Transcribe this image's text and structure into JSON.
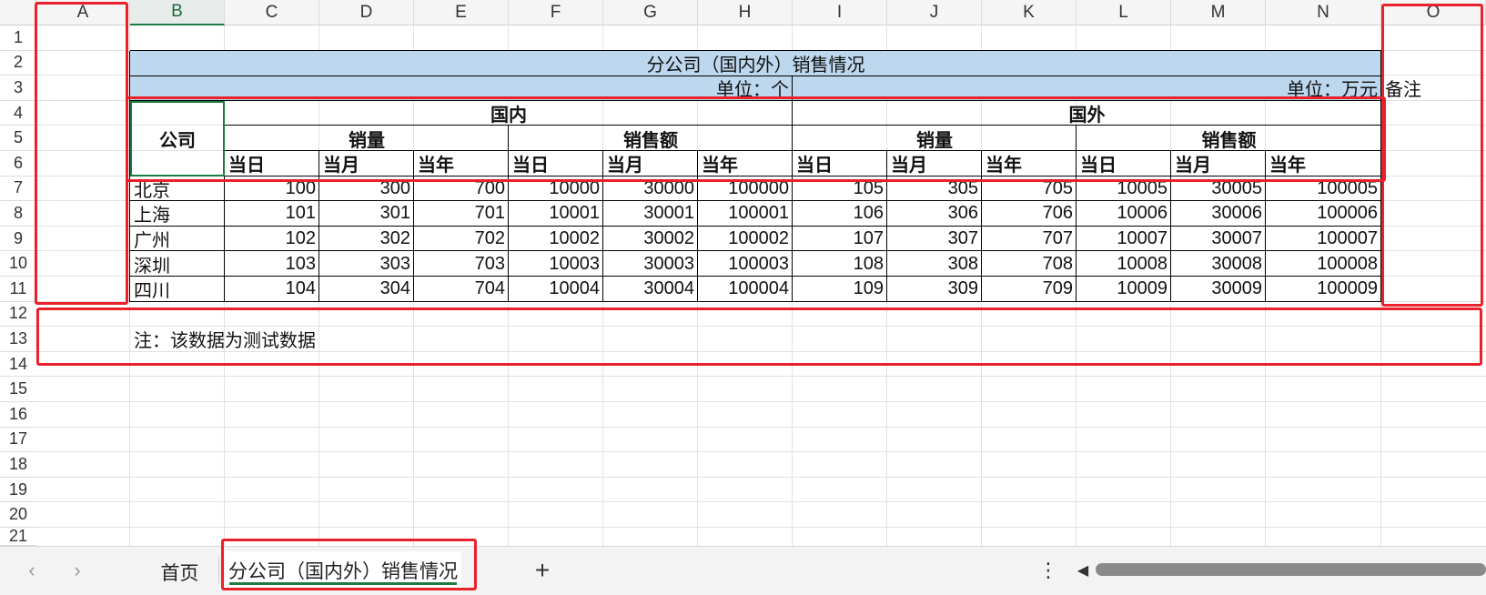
{
  "columns": [
    "A",
    "B",
    "C",
    "D",
    "E",
    "F",
    "G",
    "H",
    "I",
    "J",
    "K",
    "L",
    "M",
    "N",
    "O"
  ],
  "rows": [
    "1",
    "2",
    "3",
    "4",
    "5",
    "6",
    "7",
    "8",
    "9",
    "10",
    "11",
    "12",
    "13",
    "14",
    "15",
    "16",
    "17",
    "18",
    "19",
    "20",
    "21"
  ],
  "report": {
    "title": "分公司（国内外）销售情况",
    "unit_left": "单位：个",
    "unit_right": "单位：万元",
    "remark": "备注",
    "company_header": "公司",
    "domestic": "国内",
    "foreign": "国外",
    "sales_qty": "销量",
    "sales_amount": "销售额",
    "day": "当日",
    "month": "当月",
    "year": "当年",
    "data": [
      [
        "北京",
        "100",
        "300",
        "700",
        "10000",
        "30000",
        "100000",
        "105",
        "305",
        "705",
        "10005",
        "30005",
        "100005"
      ],
      [
        "上海",
        "101",
        "301",
        "701",
        "10001",
        "30001",
        "100001",
        "106",
        "306",
        "706",
        "10006",
        "30006",
        "100006"
      ],
      [
        "广州",
        "102",
        "302",
        "702",
        "10002",
        "30002",
        "100002",
        "107",
        "307",
        "707",
        "10007",
        "30007",
        "100007"
      ],
      [
        "深圳",
        "103",
        "303",
        "703",
        "10003",
        "30003",
        "100003",
        "108",
        "308",
        "708",
        "10008",
        "30008",
        "100008"
      ],
      [
        "四川",
        "104",
        "304",
        "704",
        "10004",
        "30004",
        "100004",
        "109",
        "309",
        "709",
        "10009",
        "30009",
        "100009"
      ]
    ],
    "note": "注：该数据为测试数据"
  },
  "tabs": {
    "prev_icon": "‹",
    "next_icon": "›",
    "home": "首页",
    "active": "分公司（国内外）销售情况",
    "add_icon": "+",
    "more_icon": "⋮",
    "scroll_left_icon": "◀"
  },
  "colors": {
    "header_fill": "#bdd7ee",
    "highlight": "#e8212b",
    "active_tab_underline": "#1c7a43"
  }
}
